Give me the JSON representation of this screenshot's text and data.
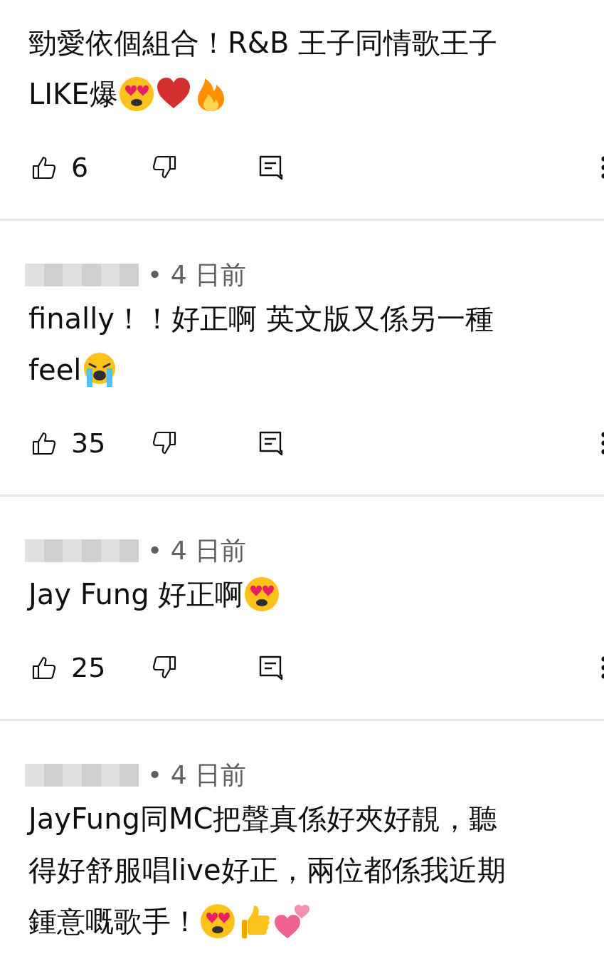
{
  "comments": [
    {
      "lines": [
        [
          {
            "kind": "text",
            "text": "勁愛依個組合！R&B 王子同情歌王子"
          }
        ],
        [
          {
            "kind": "text",
            "text": "LIKE爆"
          },
          {
            "kind": "heart_eyes"
          },
          {
            "kind": "heart"
          },
          {
            "kind": "fire"
          }
        ]
      ],
      "likes": "6"
    },
    {
      "author": {
        "redacted": true
      },
      "time": "• 4 日前",
      "lines": [
        [
          {
            "kind": "text",
            "text": "finally！！好正啊 英文版又係另一種"
          }
        ],
        [
          {
            "kind": "text",
            "text": "feel"
          },
          {
            "kind": "crying"
          }
        ]
      ],
      "likes": "35"
    },
    {
      "author": {
        "redacted": true
      },
      "time": "• 4 日前",
      "lines": [
        [
          {
            "kind": "text",
            "text": "Jay Fung 好正啊"
          },
          {
            "kind": "heart_eyes"
          }
        ]
      ],
      "likes": "25"
    },
    {
      "author": {
        "redacted": true
      },
      "time": "• 4 日前",
      "lines": [
        [
          {
            "kind": "text",
            "text": "JayFung同MC把聲真係好夾好靚，聽"
          }
        ],
        [
          {
            "kind": "text",
            "text": "得好舒服唱live好正，兩位都係我近期"
          }
        ],
        [
          {
            "kind": "text",
            "text": "鍾意嘅歌手！"
          },
          {
            "kind": "heart_eyes"
          },
          {
            "kind": "thumbs_up"
          },
          {
            "kind": "two_hearts"
          }
        ]
      ]
    }
  ]
}
